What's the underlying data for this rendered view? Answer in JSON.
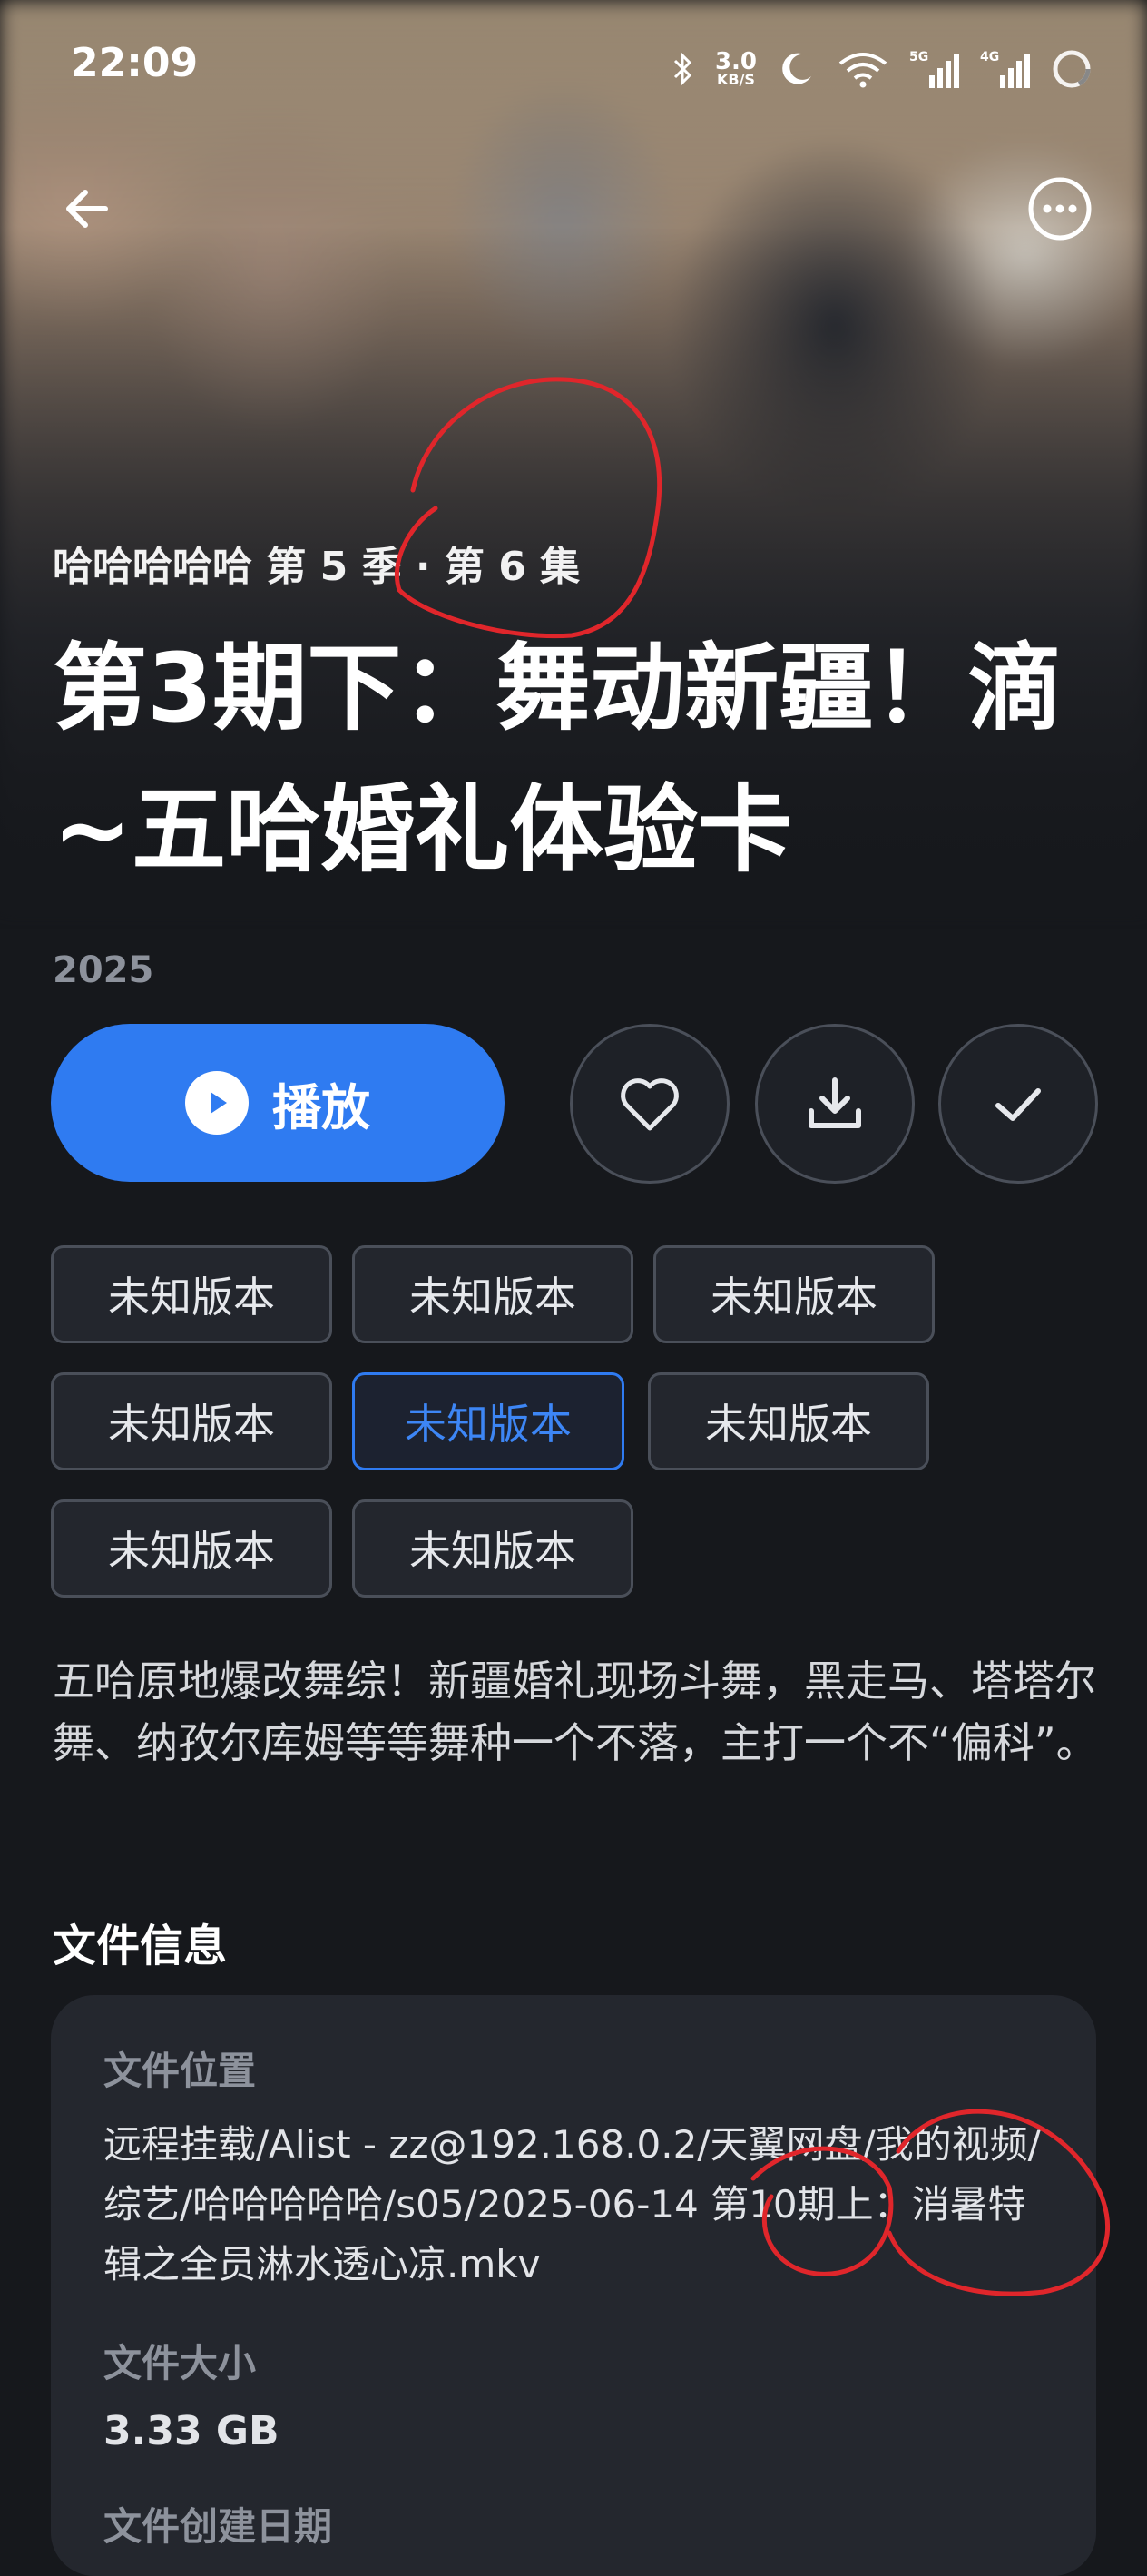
{
  "status_bar": {
    "time": "22:09",
    "net_speed_value": "3.0",
    "net_speed_unit": "KB/S",
    "icons": [
      "bluetooth-icon",
      "moon-icon",
      "wifi-icon",
      "signal-5g-icon",
      "signal-4g-icon",
      "battery-ring-icon"
    ],
    "signal_labels": [
      "5G",
      "4G"
    ]
  },
  "header": {
    "back_icon": "arrow-left-icon",
    "more_icon": "more-circle-icon"
  },
  "episode": {
    "subtitle": "哈哈哈哈哈 第 5 季 · 第 6 集",
    "title": "第3期下：舞动新疆！滴~五哈婚礼体验卡",
    "year": "2025"
  },
  "actions": {
    "play_label": "播放",
    "favorite_icon": "heart-icon",
    "download_icon": "download-icon",
    "watched_icon": "check-icon",
    "accent_color": "#2f7bf1"
  },
  "versions": {
    "items": [
      "未知版本",
      "未知版本",
      "未知版本",
      "未知版本",
      "未知版本",
      "未知版本",
      "未知版本",
      "未知版本"
    ],
    "selected_index": 4
  },
  "description": "五哈原地爆改舞综！新疆婚礼现场斗舞，黑走马、塔塔尔舞、纳孜尔库姆等等舞种一个不落，主打一个不“偏科”。",
  "file_info": {
    "section_title": "文件信息",
    "location_label": "文件位置",
    "location_value": "远程挂载/Alist - zz@192.168.0.2/天翼网盘/我的视频/综艺/哈哈哈哈哈/s05/2025-06-14 第10期上：消暑特辑之全员淋水透心凉.mkv",
    "size_label": "文件大小",
    "size_value": "3.33 GB",
    "created_label": "文件创建日期"
  }
}
